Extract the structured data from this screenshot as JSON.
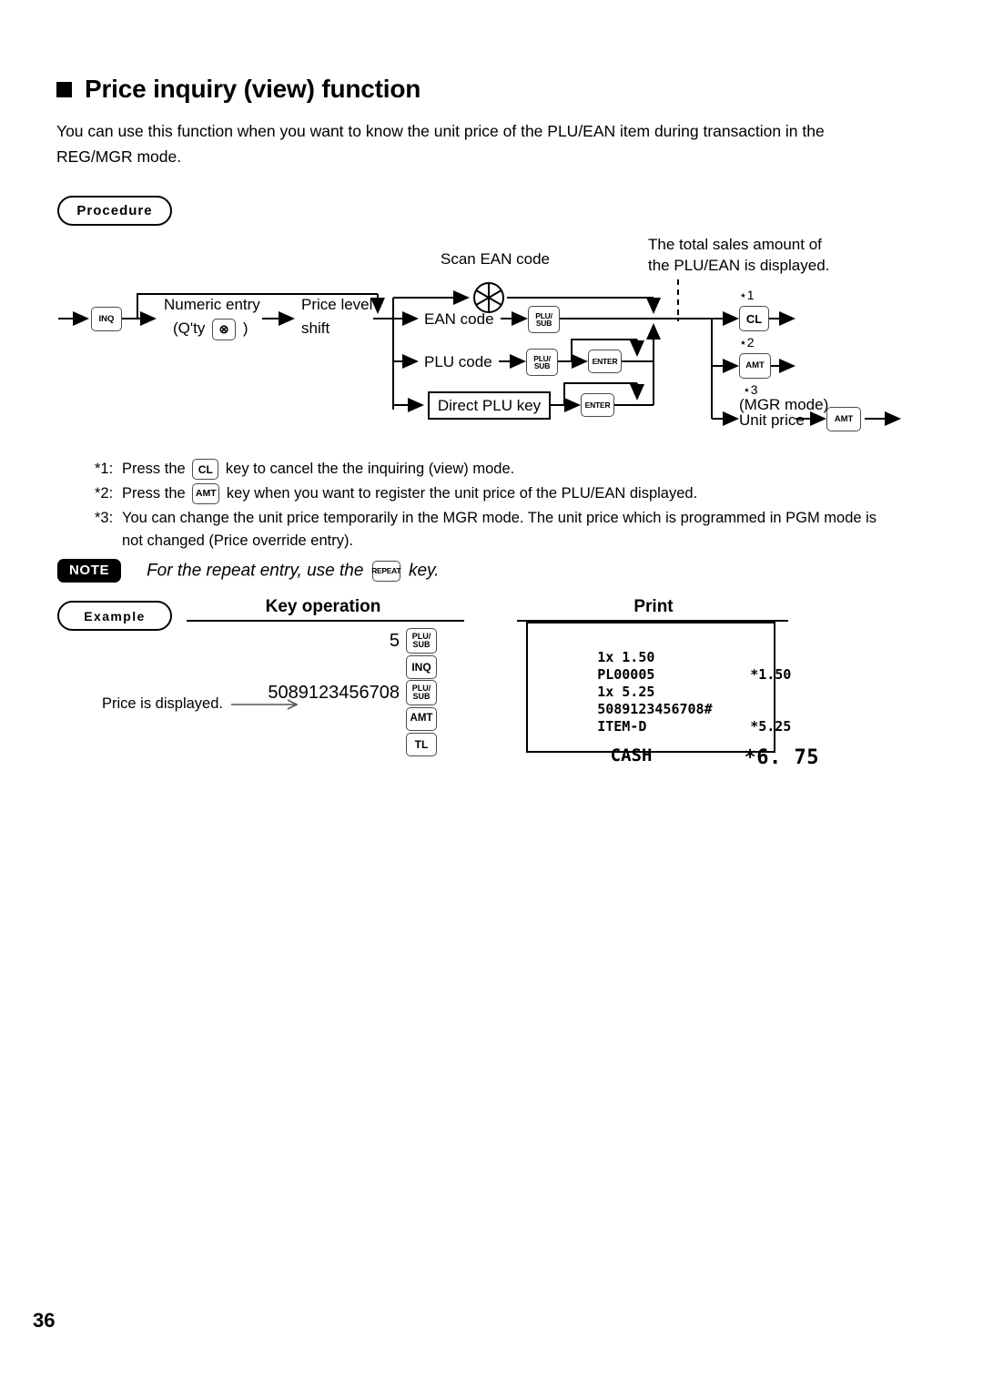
{
  "heading": {
    "title": "Price inquiry (view) function"
  },
  "intro": "You can use this function when you want to know the unit price of the PLU/EAN item during transaction in the REG/MGR mode.",
  "labels": {
    "procedure": "Procedure",
    "example": "Example",
    "key_operation": "Key operation",
    "print": "Print"
  },
  "diagram": {
    "inq_key": "INQ",
    "numeric_entry": "Numeric entry",
    "qty_prefix": "(Q'ty",
    "qty_suffix": ")",
    "qty_key": "⊗",
    "price_level_1": "Price level",
    "price_level_2": "shift",
    "scan_ean": "Scan EAN code",
    "ean_code": "EAN code",
    "plu_code": "PLU code",
    "direct_plu": "Direct PLU key",
    "plusub_top": "PLU/",
    "plusub_bottom": "SUB",
    "enter_key": "ENTER",
    "total_note_1": "The total sales amount of",
    "total_note_2": "the PLU/EAN is displayed.",
    "star1": "⋆1",
    "star2": "⋆2",
    "star3": "⋆3",
    "cl_key": "CL",
    "amt_key": "AMT",
    "mgr_mode": "(MGR mode)",
    "unit_price": "Unit price"
  },
  "footnotes": [
    {
      "mark": "*1:",
      "before": "Press the",
      "key": "CL",
      "after": "key to cancel the the inquiring (view) mode."
    },
    {
      "mark": "*2:",
      "before": "Press the",
      "key": "AMT",
      "after": "key when you want to register the unit price of the PLU/EAN displayed."
    },
    {
      "mark": "*3:",
      "before": "",
      "key": "",
      "after": "You can change the unit price temporarily in the MGR mode.  The unit price which is programmed in PGM mode is not changed (Price override entry)."
    }
  ],
  "note": {
    "badge": "NOTE",
    "text_before": "For the repeat entry, use the",
    "key": "REPEAT",
    "text_after": "key."
  },
  "example": {
    "price_displayed": "Price is displayed.",
    "rows": [
      {
        "value": "5",
        "key_top": "PLU/",
        "key_bottom": "SUB"
      },
      {
        "value": "",
        "key_top": "INQ",
        "key_bottom": ""
      },
      {
        "value": "5089123456708",
        "key_top": "PLU/",
        "key_bottom": "SUB"
      },
      {
        "value": "",
        "key_top": "AMT",
        "key_bottom": ""
      },
      {
        "value": "",
        "key_top": "TL",
        "key_bottom": ""
      }
    ]
  },
  "receipt": {
    "lines": [
      {
        "left": "1x 1.50",
        "right": ""
      },
      {
        "left": "PL00005",
        "right": "*1.50"
      },
      {
        "left": "1x 5.25",
        "right": ""
      },
      {
        "left": "5089123456708#",
        "right": ""
      },
      {
        "left": "ITEM-D",
        "right": "*5.25"
      }
    ],
    "total_label": "CASH",
    "total_value": "*6. 75"
  },
  "page_number": "36"
}
